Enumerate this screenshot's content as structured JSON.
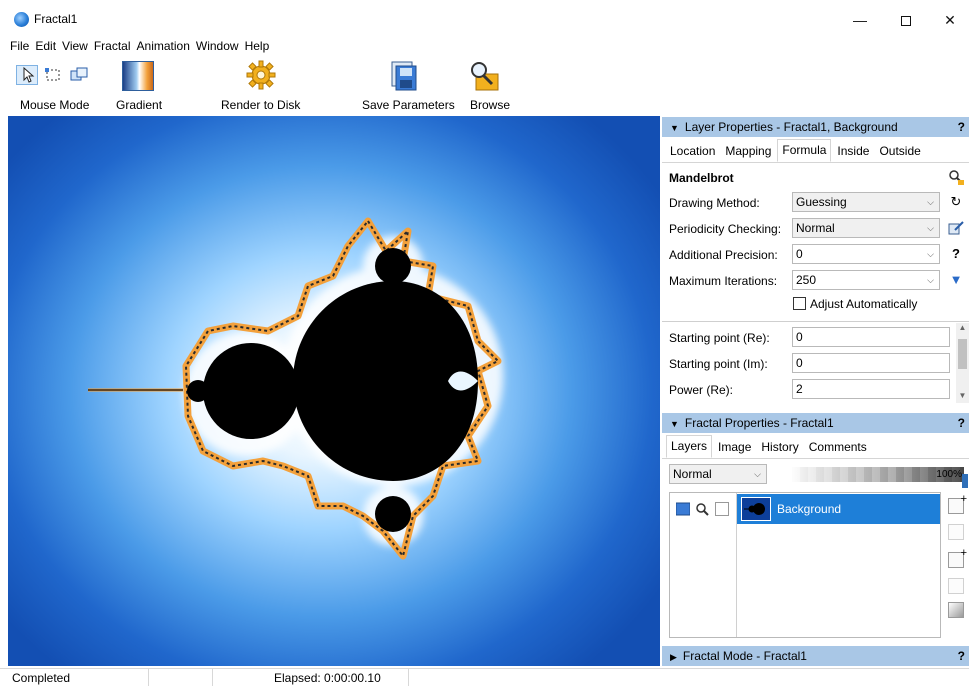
{
  "window": {
    "title": "Fractal1",
    "minimize": "—",
    "close": "✕"
  },
  "menu": [
    "File",
    "Edit",
    "View",
    "Fractal",
    "Animation",
    "Window",
    "Help"
  ],
  "toolbar": {
    "mouse_mode_label": "Mouse Mode",
    "gradient_label": "Gradient",
    "render_label": "Render to Disk",
    "save_label": "Save Parameters",
    "browse_label": "Browse"
  },
  "layer_properties": {
    "header": "Layer Properties - Fractal1, Background",
    "help": "?",
    "tabs": [
      "Location",
      "Mapping",
      "Formula",
      "Inside",
      "Outside"
    ],
    "active_tab": "Formula",
    "formula_name": "Mandelbrot",
    "drawing_method_label": "Drawing Method:",
    "drawing_method_value": "Guessing",
    "periodicity_label": "Periodicity Checking:",
    "periodicity_value": "Normal",
    "precision_label": "Additional Precision:",
    "precision_value": "0",
    "iterations_label": "Maximum Iterations:",
    "iterations_value": "250",
    "adjust_label": "Adjust Automatically",
    "start_re_label": "Starting point (Re):",
    "start_re_value": "0",
    "start_im_label": "Starting point (Im):",
    "start_im_value": "0",
    "power_label": "Power (Re):",
    "power_value": "2"
  },
  "fractal_properties": {
    "header": "Fractal Properties - Fractal1",
    "help": "?",
    "tabs": [
      "Layers",
      "Image",
      "History",
      "Comments"
    ],
    "active_tab": "Layers",
    "blend_mode": "Normal",
    "opacity": "100%",
    "layers": [
      {
        "name": "Background"
      }
    ]
  },
  "fractal_mode": {
    "header": "Fractal Mode - Fractal1",
    "help": "?"
  },
  "status": {
    "state": "Completed",
    "elapsed": "Elapsed: 0:00:00.10"
  },
  "colors": {
    "panel_header": "#a9c7e6",
    "selection": "#1e7fd8",
    "fractal_edge": "#f3a13c",
    "fractal_bg": "#134fb3"
  }
}
